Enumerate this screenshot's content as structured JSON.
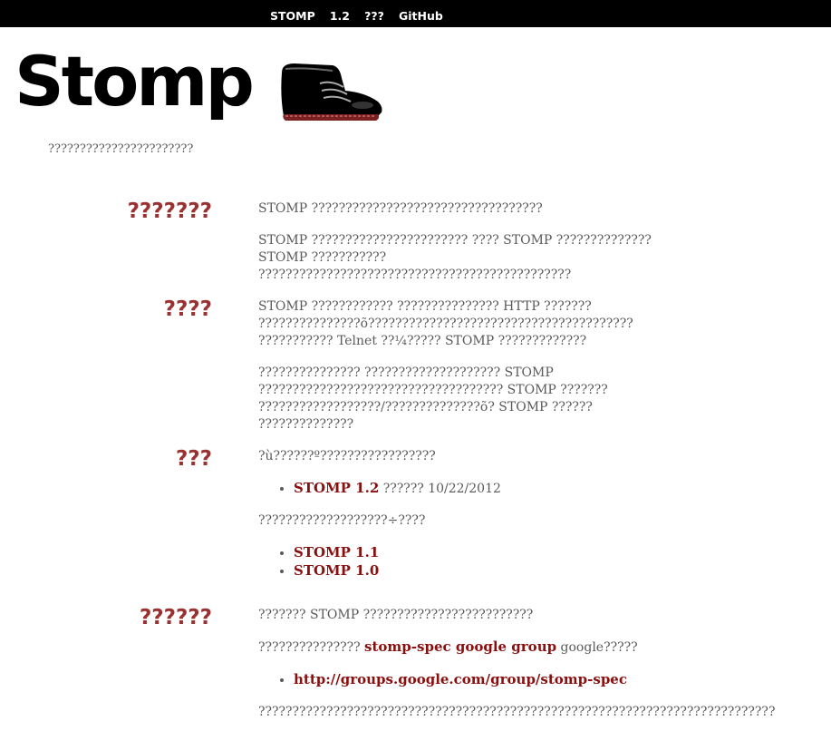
{
  "nav": {
    "items": [
      "STOMP",
      "1.2",
      "???",
      "GitHub"
    ]
  },
  "brand": {
    "logo": "Stomp",
    "tagline": "???????????????????????"
  },
  "sections": [
    {
      "title": "???????",
      "paragraphs": [
        "STOMP ??????????????????????????????????",
        "STOMP ??????????????????????? ???? STOMP ??????????????",
        "STOMP ???????????",
        "??????????????????????????????????????????????"
      ]
    },
    {
      "title": "????",
      "paragraphs": [
        "STOMP ???????????? ??????????????? HTTP ???????",
        "???????????????õ???????????????????????????????????????",
        "??????????? Telnet ??¼????? STOMP ?????????????",
        "??????????????? ???????????????????? STOMP",
        "???????????????????????????????????? STOMP ???????",
        "??????????????????/??????????????õ? STOMP ??????",
        "??????????????"
      ]
    },
    {
      "title": "???",
      "intro": "?ù??????º?????????????????",
      "current_link": "STOMP 1.2",
      "current_text": "?????? 10/22/2012",
      "older_intro": "???????????????????÷????",
      "older_links": [
        "STOMP 1.1",
        "STOMP 1.0"
      ]
    },
    {
      "title": "??????",
      "intro": "??????? STOMP ?????????????????????????",
      "group_prefix": "??????????????? ",
      "group_link": "stomp-spec google group",
      "group_suffix": " google?????",
      "group_url": "http://groups.google.com/group/stomp-spec",
      "footer": "????????????????????????????????????????????????????????????????????????????"
    }
  ]
}
